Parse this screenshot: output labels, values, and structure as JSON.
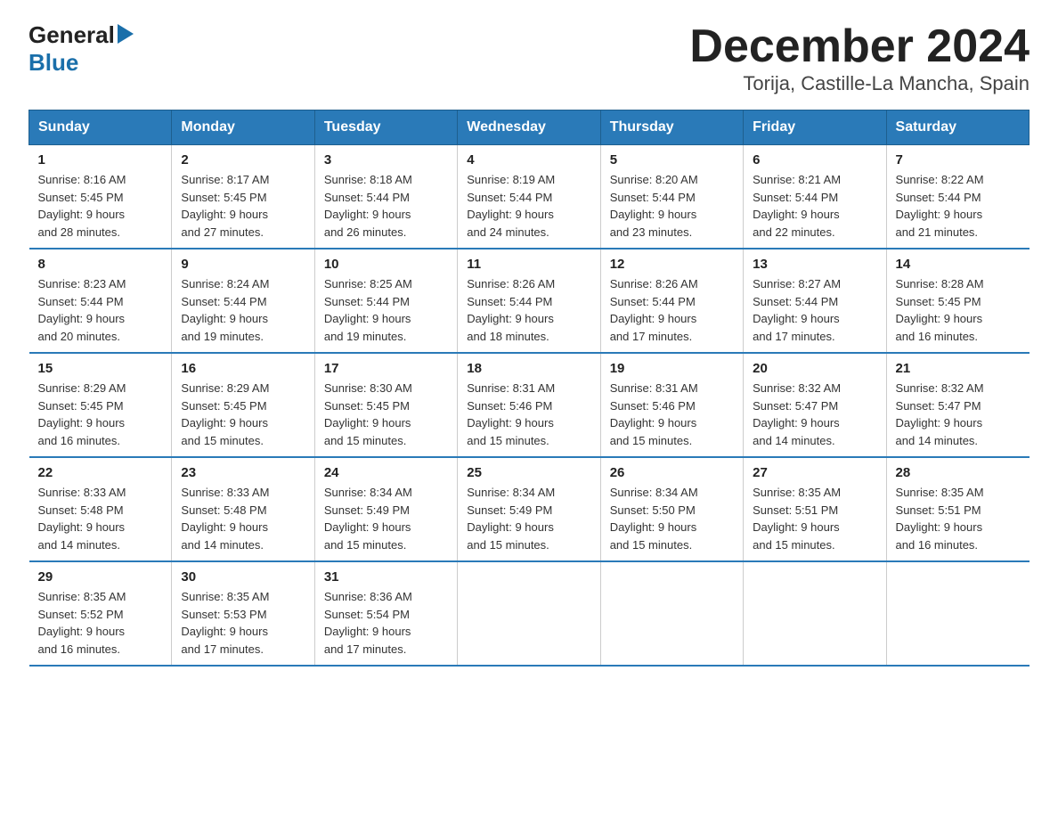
{
  "logo": {
    "general": "General",
    "blue": "Blue"
  },
  "title": "December 2024",
  "subtitle": "Torija, Castille-La Mancha, Spain",
  "days_of_week": [
    "Sunday",
    "Monday",
    "Tuesday",
    "Wednesday",
    "Thursday",
    "Friday",
    "Saturday"
  ],
  "weeks": [
    [
      {
        "day": "1",
        "sunrise": "8:16 AM",
        "sunset": "5:45 PM",
        "daylight": "9 hours and 28 minutes."
      },
      {
        "day": "2",
        "sunrise": "8:17 AM",
        "sunset": "5:45 PM",
        "daylight": "9 hours and 27 minutes."
      },
      {
        "day": "3",
        "sunrise": "8:18 AM",
        "sunset": "5:44 PM",
        "daylight": "9 hours and 26 minutes."
      },
      {
        "day": "4",
        "sunrise": "8:19 AM",
        "sunset": "5:44 PM",
        "daylight": "9 hours and 24 minutes."
      },
      {
        "day": "5",
        "sunrise": "8:20 AM",
        "sunset": "5:44 PM",
        "daylight": "9 hours and 23 minutes."
      },
      {
        "day": "6",
        "sunrise": "8:21 AM",
        "sunset": "5:44 PM",
        "daylight": "9 hours and 22 minutes."
      },
      {
        "day": "7",
        "sunrise": "8:22 AM",
        "sunset": "5:44 PM",
        "daylight": "9 hours and 21 minutes."
      }
    ],
    [
      {
        "day": "8",
        "sunrise": "8:23 AM",
        "sunset": "5:44 PM",
        "daylight": "9 hours and 20 minutes."
      },
      {
        "day": "9",
        "sunrise": "8:24 AM",
        "sunset": "5:44 PM",
        "daylight": "9 hours and 19 minutes."
      },
      {
        "day": "10",
        "sunrise": "8:25 AM",
        "sunset": "5:44 PM",
        "daylight": "9 hours and 19 minutes."
      },
      {
        "day": "11",
        "sunrise": "8:26 AM",
        "sunset": "5:44 PM",
        "daylight": "9 hours and 18 minutes."
      },
      {
        "day": "12",
        "sunrise": "8:26 AM",
        "sunset": "5:44 PM",
        "daylight": "9 hours and 17 minutes."
      },
      {
        "day": "13",
        "sunrise": "8:27 AM",
        "sunset": "5:44 PM",
        "daylight": "9 hours and 17 minutes."
      },
      {
        "day": "14",
        "sunrise": "8:28 AM",
        "sunset": "5:45 PM",
        "daylight": "9 hours and 16 minutes."
      }
    ],
    [
      {
        "day": "15",
        "sunrise": "8:29 AM",
        "sunset": "5:45 PM",
        "daylight": "9 hours and 16 minutes."
      },
      {
        "day": "16",
        "sunrise": "8:29 AM",
        "sunset": "5:45 PM",
        "daylight": "9 hours and 15 minutes."
      },
      {
        "day": "17",
        "sunrise": "8:30 AM",
        "sunset": "5:45 PM",
        "daylight": "9 hours and 15 minutes."
      },
      {
        "day": "18",
        "sunrise": "8:31 AM",
        "sunset": "5:46 PM",
        "daylight": "9 hours and 15 minutes."
      },
      {
        "day": "19",
        "sunrise": "8:31 AM",
        "sunset": "5:46 PM",
        "daylight": "9 hours and 15 minutes."
      },
      {
        "day": "20",
        "sunrise": "8:32 AM",
        "sunset": "5:47 PM",
        "daylight": "9 hours and 14 minutes."
      },
      {
        "day": "21",
        "sunrise": "8:32 AM",
        "sunset": "5:47 PM",
        "daylight": "9 hours and 14 minutes."
      }
    ],
    [
      {
        "day": "22",
        "sunrise": "8:33 AM",
        "sunset": "5:48 PM",
        "daylight": "9 hours and 14 minutes."
      },
      {
        "day": "23",
        "sunrise": "8:33 AM",
        "sunset": "5:48 PM",
        "daylight": "9 hours and 14 minutes."
      },
      {
        "day": "24",
        "sunrise": "8:34 AM",
        "sunset": "5:49 PM",
        "daylight": "9 hours and 15 minutes."
      },
      {
        "day": "25",
        "sunrise": "8:34 AM",
        "sunset": "5:49 PM",
        "daylight": "9 hours and 15 minutes."
      },
      {
        "day": "26",
        "sunrise": "8:34 AM",
        "sunset": "5:50 PM",
        "daylight": "9 hours and 15 minutes."
      },
      {
        "day": "27",
        "sunrise": "8:35 AM",
        "sunset": "5:51 PM",
        "daylight": "9 hours and 15 minutes."
      },
      {
        "day": "28",
        "sunrise": "8:35 AM",
        "sunset": "5:51 PM",
        "daylight": "9 hours and 16 minutes."
      }
    ],
    [
      {
        "day": "29",
        "sunrise": "8:35 AM",
        "sunset": "5:52 PM",
        "daylight": "9 hours and 16 minutes."
      },
      {
        "day": "30",
        "sunrise": "8:35 AM",
        "sunset": "5:53 PM",
        "daylight": "9 hours and 17 minutes."
      },
      {
        "day": "31",
        "sunrise": "8:36 AM",
        "sunset": "5:54 PM",
        "daylight": "9 hours and 17 minutes."
      },
      null,
      null,
      null,
      null
    ]
  ],
  "labels": {
    "sunrise_prefix": "Sunrise: ",
    "sunset_prefix": "Sunset: ",
    "daylight_prefix": "Daylight: "
  }
}
